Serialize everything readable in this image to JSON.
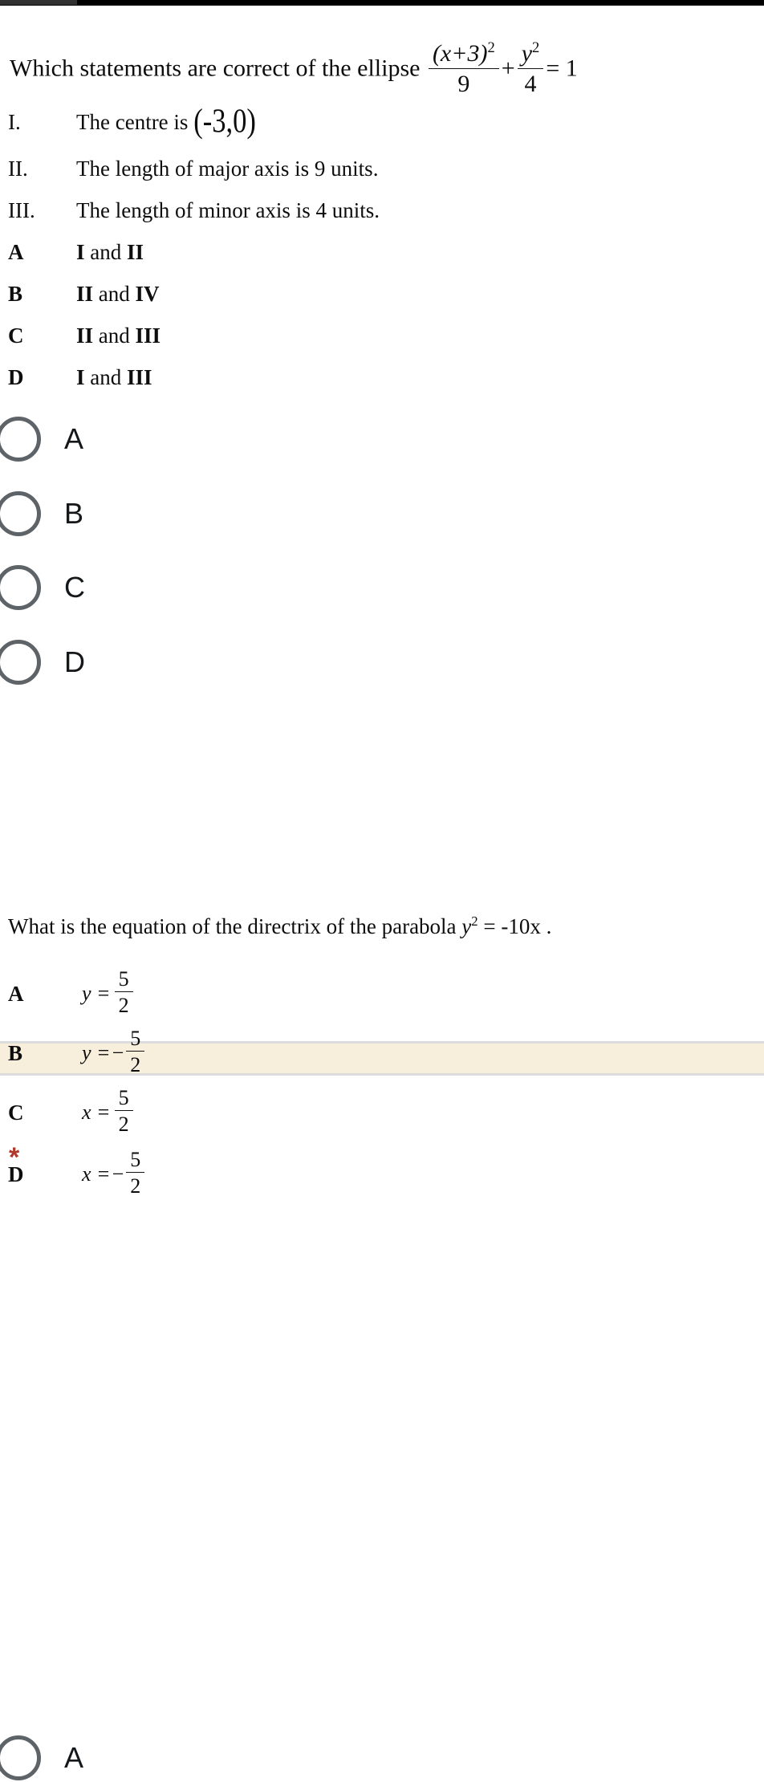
{
  "topbar": {
    "accent_left_color": "#313131",
    "color": "#000000"
  },
  "colors": {
    "band_background": "#f7efdc",
    "band_border": "#dcdcdc",
    "required_asterisk": "#b0392c",
    "radio_outline": "#5e6367",
    "text": "#0d0d0d"
  },
  "question1": {
    "stem_prefix": "Which statements are correct of the ellipse",
    "equation": {
      "term1": {
        "numerator": "(x+3)",
        "numerator_exponent": "2",
        "denominator": "9"
      },
      "operator": "+",
      "term2": {
        "numerator": "y",
        "numerator_exponent": "2",
        "denominator": "4"
      },
      "equals": "= 1"
    },
    "statements": [
      {
        "marker": "I.",
        "text_prefix": "The centre is",
        "coordinate": "(-3,0)"
      },
      {
        "marker": "II.",
        "text": "The length of major axis is 9 units."
      },
      {
        "marker": "III.",
        "text": "The length of minor axis is 4 units."
      }
    ],
    "options": [
      {
        "marker": "A",
        "first": "I",
        "conjunction": "and",
        "second": "II"
      },
      {
        "marker": "B",
        "first": "II",
        "conjunction": "and",
        "second": "IV"
      },
      {
        "marker": "C",
        "first": "II",
        "conjunction": "and",
        "second": "III"
      },
      {
        "marker": "D",
        "first": "I",
        "conjunction": "and",
        "second": "III"
      }
    ],
    "radio_choices": [
      {
        "label": "A",
        "selected": false
      },
      {
        "label": "B",
        "selected": false
      },
      {
        "label": "C",
        "selected": false
      },
      {
        "label": "D",
        "selected": false
      }
    ]
  },
  "question2": {
    "required_marker": "*",
    "stem_prefix": "What is the equation of the directrix of the parabola",
    "equation": {
      "variable": "y",
      "exponent": "2",
      "rhs": "= -10x",
      "period": "."
    },
    "options": [
      {
        "marker": "A",
        "lead": "y =",
        "numerator": "5",
        "denominator": "2",
        "sign": ""
      },
      {
        "marker": "B",
        "lead": "y =",
        "numerator": "5",
        "denominator": "2",
        "sign": "−"
      },
      {
        "marker": "C",
        "lead": "x =",
        "numerator": "5",
        "denominator": "2",
        "sign": ""
      },
      {
        "marker": "D",
        "lead": "x =",
        "numerator": "5",
        "denominator": "2",
        "sign": "−"
      }
    ],
    "radio_choices": [
      {
        "label": "A",
        "selected": false
      }
    ]
  }
}
